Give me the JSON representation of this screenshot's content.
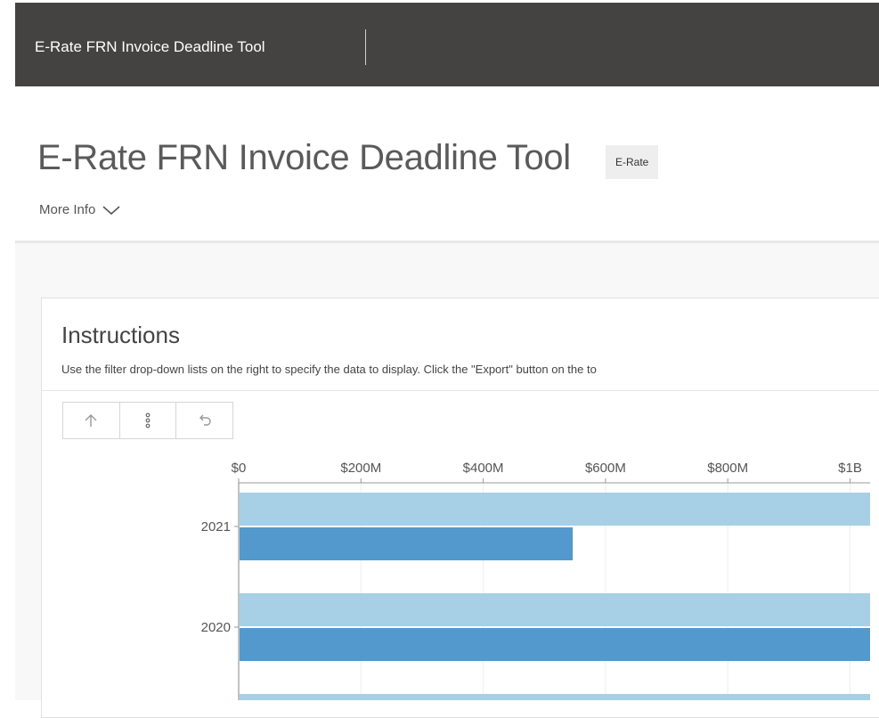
{
  "topbar": {
    "app_name": "E-Rate FRN Invoice Deadline Tool"
  },
  "header": {
    "title": "E-Rate FRN Invoice Deadline Tool",
    "tag": "E-Rate",
    "more_info": "More Info"
  },
  "card": {
    "title": "Instructions",
    "description": "Use the filter drop-down lists on the right to specify the data to display. Click the \"Export\" button on the to"
  },
  "toolbar": {
    "buttons": [
      {
        "icon": "arrow-up-icon"
      },
      {
        "icon": "vertical-dots-icon"
      },
      {
        "icon": "undo-icon"
      }
    ]
  },
  "colors": {
    "topbar": "#444342",
    "series_light": "#a7cfe6",
    "series_dark": "#5399cd"
  },
  "chart_data": {
    "type": "bar",
    "orientation": "horizontal",
    "x_ticks": [
      "$0",
      "$200M",
      "$400M",
      "$600M",
      "$800M",
      "$1B"
    ],
    "xlim": [
      0,
      1000000000
    ],
    "categories": [
      "2021",
      "2020"
    ],
    "series": [
      {
        "values": [
          1040000000,
          1040000000
        ],
        "color": "#a7cfe6"
      },
      {
        "values": [
          545000000,
          1040000000
        ],
        "color": "#5399cd"
      }
    ],
    "grid": true
  }
}
